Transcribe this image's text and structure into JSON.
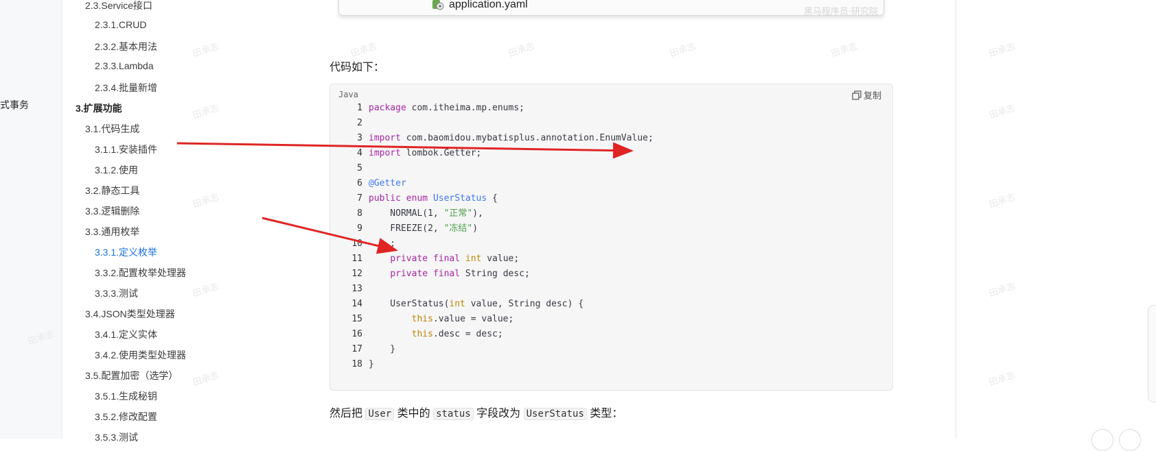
{
  "left_strip": {
    "cut_label": "式事务"
  },
  "toc": [
    {
      "label": "2.3.Service接口",
      "level": 2,
      "active": false
    },
    {
      "label": "2.3.1.CRUD",
      "level": 3,
      "active": false
    },
    {
      "label": "2.3.2.基本用法",
      "level": 3,
      "active": false
    },
    {
      "label": "2.3.3.Lambda",
      "level": 3,
      "active": false
    },
    {
      "label": "2.3.4.批量新增",
      "level": 3,
      "active": false
    },
    {
      "label": "3.扩展功能",
      "level": 1,
      "active": false
    },
    {
      "label": "3.1.代码生成",
      "level": 2,
      "active": false
    },
    {
      "label": "3.1.1.安装插件",
      "level": 3,
      "active": false
    },
    {
      "label": "3.1.2.使用",
      "level": 3,
      "active": false
    },
    {
      "label": "3.2.静态工具",
      "level": 2,
      "active": false
    },
    {
      "label": "3.3.逻辑删除",
      "level": 2,
      "active": false
    },
    {
      "label": "3.3.通用枚举",
      "level": 2,
      "active": false
    },
    {
      "label": "3.3.1.定义枚举",
      "level": 3,
      "active": true
    },
    {
      "label": "3.3.2.配置枚举处理器",
      "level": 3,
      "active": false
    },
    {
      "label": "3.3.3.测试",
      "level": 3,
      "active": false
    },
    {
      "label": "3.4.JSON类型处理器",
      "level": 2,
      "active": false
    },
    {
      "label": "3.4.1.定义实体",
      "level": 3,
      "active": false
    },
    {
      "label": "3.4.2.使用类型处理器",
      "level": 3,
      "active": false
    },
    {
      "label": "3.5.配置加密（选学）",
      "level": 2,
      "active": false
    },
    {
      "label": "3.5.1.生成秘钥",
      "level": 3,
      "active": false
    },
    {
      "label": "3.5.2.修改配置",
      "level": 3,
      "active": false
    },
    {
      "label": "3.5.3.测试",
      "level": 3,
      "active": false
    }
  ],
  "image_strip": {
    "file_name": "application.yaml",
    "watermark": "黑马程序员·研究院"
  },
  "intro_text": "代码如下：",
  "code": {
    "lang": "Java",
    "copy_label": "复制",
    "lines": [
      [
        [
          "kw",
          "package"
        ],
        [
          "p",
          " com.itheima.mp.enums;"
        ]
      ],
      [],
      [
        [
          "kw",
          "import"
        ],
        [
          "p",
          " com.baomidou.mybatisplus.annotation.EnumValue;"
        ]
      ],
      [
        [
          "kw",
          "import"
        ],
        [
          "p",
          " lombok.Getter;"
        ]
      ],
      [],
      [
        [
          "an",
          "@Getter"
        ]
      ],
      [
        [
          "kw",
          "public"
        ],
        [
          "p",
          " "
        ],
        [
          "kw",
          "enum"
        ],
        [
          "p",
          " "
        ],
        [
          "cl",
          "UserStatus"
        ],
        [
          "p",
          " {"
        ]
      ],
      [
        [
          "p",
          "    NORMAL(1, "
        ],
        [
          "st",
          "\"正常\""
        ],
        [
          "p",
          "),"
        ]
      ],
      [
        [
          "p",
          "    FREEZE(2, "
        ],
        [
          "st",
          "\"冻结\""
        ],
        [
          "p",
          ")"
        ]
      ],
      [
        [
          "p",
          "    ;"
        ]
      ],
      [
        [
          "p",
          "    "
        ],
        [
          "kw",
          "private"
        ],
        [
          "p",
          " "
        ],
        [
          "kw",
          "final"
        ],
        [
          "p",
          " "
        ],
        [
          "ty",
          "int"
        ],
        [
          "p",
          " value;"
        ]
      ],
      [
        [
          "p",
          "    "
        ],
        [
          "kw",
          "private"
        ],
        [
          "p",
          " "
        ],
        [
          "kw",
          "final"
        ],
        [
          "p",
          " String desc;"
        ]
      ],
      [],
      [
        [
          "p",
          "    UserStatus("
        ],
        [
          "ty",
          "int"
        ],
        [
          "p",
          " value, String desc) {"
        ]
      ],
      [
        [
          "p",
          "        "
        ],
        [
          "ty",
          "this"
        ],
        [
          "p",
          ".value = value;"
        ]
      ],
      [
        [
          "p",
          "        "
        ],
        [
          "ty",
          "this"
        ],
        [
          "p",
          ".desc = desc;"
        ]
      ],
      [
        [
          "p",
          "    }"
        ]
      ],
      [
        [
          "p",
          "}"
        ]
      ]
    ]
  },
  "bottom_text": {
    "t1": "然后把",
    "c1": "User",
    "t2": "类中的",
    "c2": "status",
    "t3": "字段改为",
    "c3": "UserStatus",
    "t4": "类型："
  },
  "watermark_text": "田承志",
  "colors": {
    "accent": "#1e6fe0",
    "arrow": "#e02424",
    "code_bg": "#f6f6f7"
  }
}
